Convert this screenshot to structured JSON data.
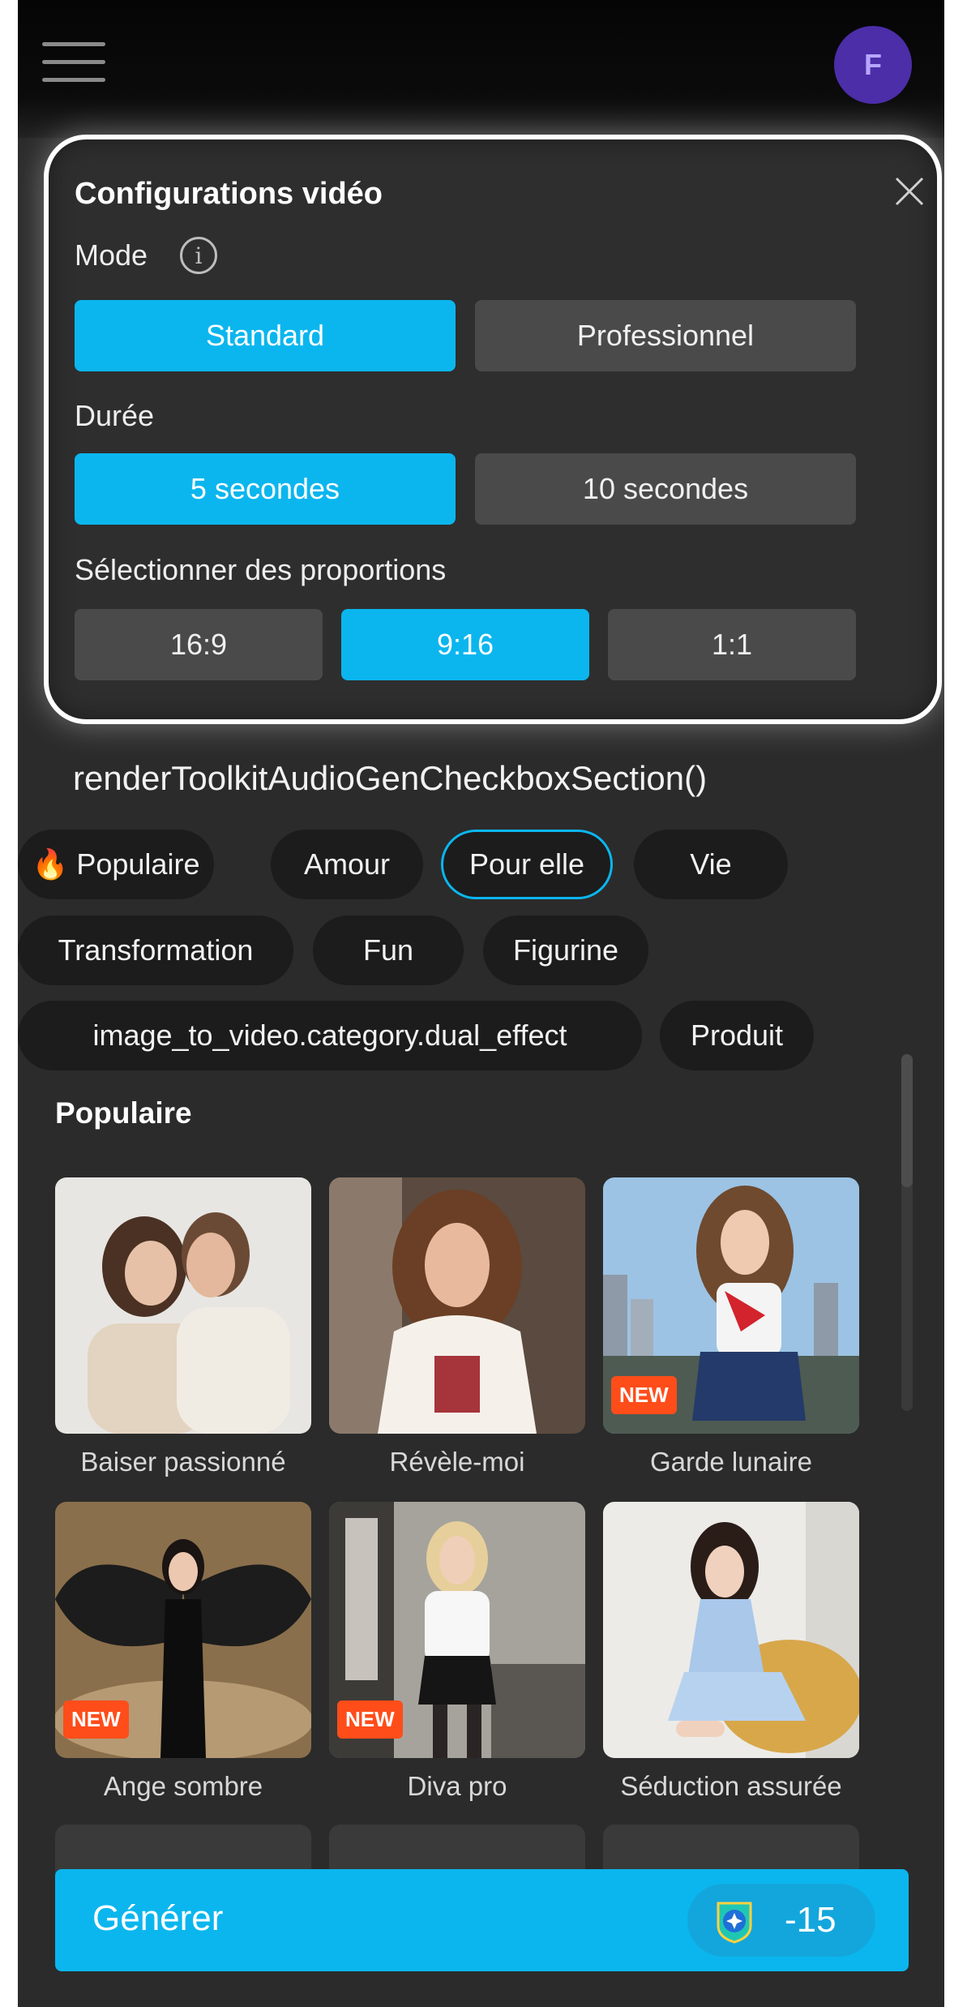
{
  "header": {
    "avatar_initial": "F"
  },
  "video_settings": {
    "title": "Configurations vidéo",
    "mode_label": "Mode",
    "modes": [
      "Standard",
      "Professionnel"
    ],
    "mode_selected": "Standard",
    "duration_label": "Durée",
    "durations": [
      "5 secondes",
      "10 secondes"
    ],
    "duration_selected": "5 secondes",
    "ratio_label": "Sélectionner des proportions",
    "ratios": [
      "16:9",
      "9:16",
      "1:1"
    ],
    "ratio_selected": "9:16"
  },
  "audio_section_text": "renderToolkitAudioGenCheckboxSection()",
  "categories": [
    {
      "label": "🔥 Populaire"
    },
    {
      "label": "Amour"
    },
    {
      "label": "Pour elle",
      "selected": true
    },
    {
      "label": "Vie"
    },
    {
      "label": "Transformation"
    },
    {
      "label": "Fun"
    },
    {
      "label": "Figurine"
    },
    {
      "label": "image_to_video.category.dual_effect"
    },
    {
      "label": "Produit"
    }
  ],
  "section_title": "Populaire",
  "templates": [
    {
      "label": "Baiser passionné",
      "new": false
    },
    {
      "label": "Révèle-moi",
      "new": false
    },
    {
      "label": "Garde lunaire",
      "new": true,
      "badge": "NEW"
    },
    {
      "label": "Ange sombre",
      "new": true,
      "badge": "NEW"
    },
    {
      "label": "Diva pro",
      "new": true,
      "badge": "NEW"
    },
    {
      "label": "Séduction assurée",
      "new": false
    }
  ],
  "generate": {
    "label": "Générer",
    "cost": "-15"
  },
  "colors": {
    "accent": "#0bb6ee",
    "background": "#2b2b2b",
    "chip": "#1c1c1c",
    "new_badge": "#ff4d1a",
    "avatar": "#4b2ea8"
  }
}
